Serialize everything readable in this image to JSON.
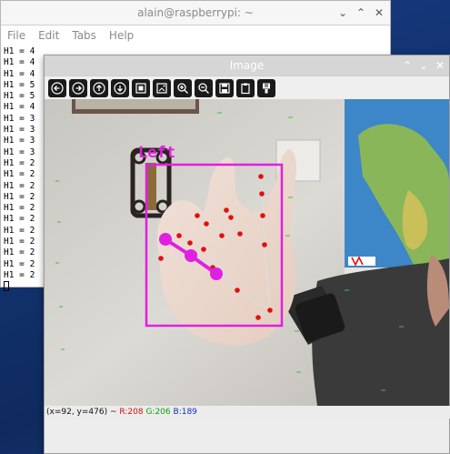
{
  "terminal": {
    "title": "alain@raspberrypi: ~",
    "menu": [
      "File",
      "Edit",
      "Tabs",
      "Help"
    ],
    "lines": [
      "H1 = 4",
      "H1 = 4",
      "H1 = 4",
      "H1 = 5",
      "H1 = 5",
      "H1 = 4",
      "H1 = 3",
      "H1 = 3",
      "H1 = 3",
      "H1 = 3",
      "H1 = 2",
      "H1 = 2",
      "H1 = 2",
      "H1 = 2",
      "H1 = 2",
      "H1 = 2",
      "H1 = 2",
      "H1 = 2",
      "H1 = 2",
      "H1 = 2",
      "H1 = 2"
    ]
  },
  "image_window": {
    "title": "Image",
    "toolbar": [
      "arrow-left-icon",
      "arrow-right-icon",
      "arrow-up-icon",
      "arrow-down-icon",
      "fit-window-icon",
      "zoom-original-icon",
      "zoom-in-icon",
      "zoom-out-icon",
      "save-image-icon",
      "copy-clipboard-icon",
      "properties-icon"
    ],
    "overlay_label": "Left",
    "status": {
      "coords": "(x=92, y=476) ~",
      "r": "R:208",
      "g": "G:206",
      "b": "B:189"
    }
  },
  "colors": {
    "overlay": "#e020e0",
    "landmark": "#e01010",
    "desktop": "#12336e"
  }
}
